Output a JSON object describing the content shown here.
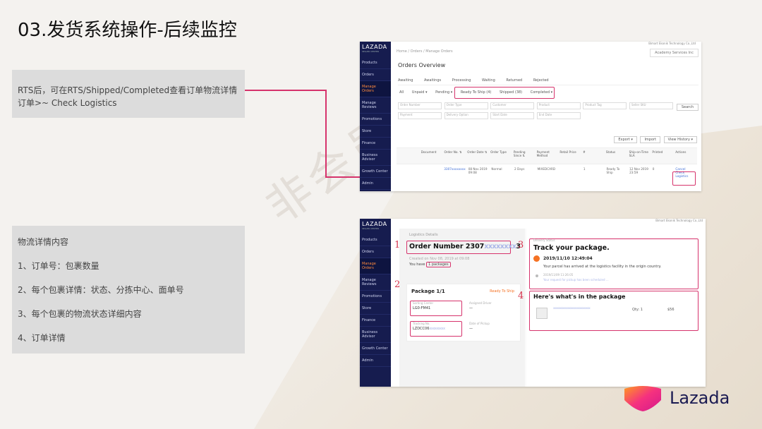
{
  "title": "03.发货系统操作-后续监控",
  "watermark": "非会员水印",
  "note1": {
    "line1": "RTS后，可在RTS/Shipped/Completed查看订单物流详情",
    "line2": "订单>~ Check Logistics"
  },
  "note2": {
    "heading": "物流详情内容",
    "items": [
      "1、订单号：包裹数量",
      "2、每个包裹详情：状态、分拣中心、面单号",
      "3、每个包裹的物流状态详细内容",
      "4、订单详情"
    ]
  },
  "shot1": {
    "logo": "LAZADA",
    "logo_sub": "SELLER CENTER",
    "sidebar": [
      "Products",
      "Orders",
      "Manage Orders",
      "Manage Reviews",
      "Promotions",
      "Store",
      "Finance",
      "Business Advisor",
      "Growth Center",
      "Admin"
    ],
    "breadcrumb": "Home  /  Orders  /  Manage Orders",
    "brand": "Bimart Ekonik Technology Co.,Ltd",
    "lang_button": "Academy Services Inc",
    "page_title": "Orders Overview",
    "tabs": [
      "Awaiting",
      "Awaitings",
      "Processing",
      "Waiting",
      "Returned",
      "Rejected"
    ],
    "subtabs": [
      "All",
      "Unpaid ▾",
      "Pending ▾",
      "Ready To Ship (4)",
      "Shipped (38)",
      "Completed ▾"
    ],
    "filters": [
      "Order Number",
      "Order Type",
      "Customer",
      "Product",
      "Product Tag",
      "Seller SKU",
      "Payment",
      "Delivery Option",
      "Start Date",
      "End Date"
    ],
    "search": "Search",
    "toolbar": [
      "Export ▾",
      "Import",
      "View History ▾"
    ],
    "table_head": [
      "",
      "Document",
      "Order No. ⇅",
      "Order Date ⇅",
      "Order Type",
      "Pending Since ⇅",
      "Payment Method",
      "Retail Price",
      "#",
      "Status",
      "Ship-on-Time SLA",
      "Printed",
      "Actions"
    ],
    "row": [
      "",
      "",
      "3307xxxxxxxx",
      "08 Nov 2019 09:08",
      "Normal",
      "2 Days",
      "MIXEDCARD",
      "",
      "1",
      "Ready To Ship",
      "12 Nov 2019 23:59",
      "0",
      "Cancel\nCheck Logistics"
    ]
  },
  "shot2": {
    "logo": "LAZADA",
    "logo_sub": "SELLER CENTER",
    "sidebar": [
      "Products",
      "Orders",
      "Manage Orders",
      "Manage Reviews",
      "Promotions",
      "Store",
      "Finance",
      "Business Advisor",
      "Growth Center",
      "Admin"
    ],
    "logistics_label": "Logistics Details",
    "order_number": "Order Number 2307",
    "order_blur": "xxxxxxxx",
    "order_tail": "3",
    "created": "Created on Nov 08, 2019 at 09:08",
    "you_have": "You have",
    "packages": "1 packages",
    "package_title": "Package 1/1",
    "package_status": "Ready To Ship",
    "sort_center_label": "Sorting Center",
    "sort_center": "LG0-FM41",
    "assigned_label": "Assigned Driver",
    "assigned": "—",
    "tracking_label": "Tracking No.",
    "tracking": "LZDCC06",
    "tracking_blur": "xxxxxxxxx",
    "date_label": "Date of Pickup",
    "date_val": "—",
    "delivery_status_label": "Delivery Status",
    "track_title": "Track your package.",
    "event_time": "2019/11/10 12:49:04",
    "event_desc": "Your parcel has arrived at the logistics facility in the origin country.",
    "event2_time": "2019/11/09 11:26:05",
    "event2_desc": "Your request for pickup has been scheduled ...",
    "whats_title": "Here's what's in the package",
    "item_name": "xxxxxxxxxxxxxxxxxxxxxxxxxxxx",
    "item_qty": "Qty: 1",
    "item_price": "$56",
    "brand": "Bimart Ekonik Technology Co.,Ltd",
    "labels": [
      "1",
      "2",
      "3",
      "4"
    ]
  },
  "lazada_logo": "Lazada",
  "colors": {
    "highlight": "#d6336c",
    "sidebar": "#161c4f",
    "accent": "#f57224"
  }
}
